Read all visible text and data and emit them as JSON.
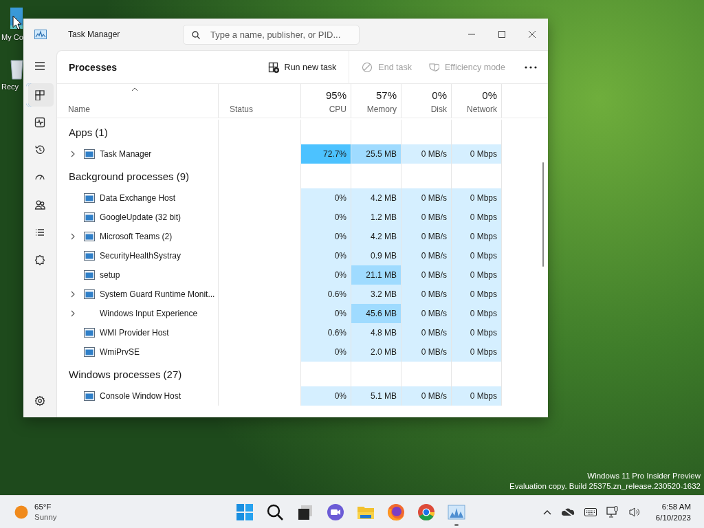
{
  "desktop": {
    "icons": [
      {
        "label": "My Co"
      },
      {
        "label": "Recy"
      }
    ],
    "build_info": [
      "Windows 11 Pro Insider Preview",
      "Evaluation copy. Build 25375.zn_release.230520-1632"
    ]
  },
  "window": {
    "title": "Task Manager",
    "search": {
      "placeholder": "Type a name, publisher, or PID..."
    }
  },
  "nav": {
    "items": [
      {
        "kind": "processes",
        "selected": true
      },
      {
        "kind": "performance",
        "selected": false
      },
      {
        "kind": "history",
        "selected": false
      },
      {
        "kind": "startup",
        "selected": false
      },
      {
        "kind": "users",
        "selected": false
      },
      {
        "kind": "details",
        "selected": false
      },
      {
        "kind": "services",
        "selected": false
      }
    ]
  },
  "page_title": "Processes",
  "toolbar": [
    {
      "label": "Run new task",
      "disabled": false
    },
    {
      "label": "End task",
      "disabled": true
    },
    {
      "label": "Efficiency mode",
      "disabled": true
    }
  ],
  "table": {
    "columns": [
      {
        "label": "Name"
      },
      {
        "label": "Status"
      },
      {
        "total": "95%",
        "label": "CPU"
      },
      {
        "total": "57%",
        "label": "Memory"
      },
      {
        "total": "0%",
        "label": "Disk"
      },
      {
        "total": "0%",
        "label": "Network"
      }
    ],
    "groups": [
      {
        "title": "Apps (1)",
        "rows": [
          {
            "name": "Task Manager",
            "expandable": true,
            "icon": true,
            "cells": [
              {
                "text": "72.7%",
                "color": "#4cc2ff"
              },
              {
                "text": "25.5 MB",
                "color": "#9fdbff"
              },
              {
                "text": "0 MB/s",
                "color": "#d5efff"
              },
              {
                "text": "0 Mbps",
                "color": "#d5efff"
              }
            ]
          }
        ]
      },
      {
        "title": "Background processes (9)",
        "rows": [
          {
            "name": "Data Exchange Host",
            "expandable": false,
            "icon": true,
            "cells": [
              {
                "text": "0%",
                "color": "#d5efff"
              },
              {
                "text": "4.2 MB",
                "color": "#d5efff"
              },
              {
                "text": "0 MB/s",
                "color": "#d5efff"
              },
              {
                "text": "0 Mbps",
                "color": "#d5efff"
              }
            ]
          },
          {
            "name": "GoogleUpdate (32 bit)",
            "expandable": false,
            "icon": true,
            "cells": [
              {
                "text": "0%",
                "color": "#d5efff"
              },
              {
                "text": "1.2 MB",
                "color": "#d5efff"
              },
              {
                "text": "0 MB/s",
                "color": "#d5efff"
              },
              {
                "text": "0 Mbps",
                "color": "#d5efff"
              }
            ]
          },
          {
            "name": "Microsoft Teams (2)",
            "expandable": true,
            "icon": true,
            "cells": [
              {
                "text": "0%",
                "color": "#d5efff"
              },
              {
                "text": "4.2 MB",
                "color": "#d5efff"
              },
              {
                "text": "0 MB/s",
                "color": "#d5efff"
              },
              {
                "text": "0 Mbps",
                "color": "#d5efff"
              }
            ]
          },
          {
            "name": "SecurityHealthSystray",
            "expandable": false,
            "icon": true,
            "cells": [
              {
                "text": "0%",
                "color": "#d5efff"
              },
              {
                "text": "0.9 MB",
                "color": "#d5efff"
              },
              {
                "text": "0 MB/s",
                "color": "#d5efff"
              },
              {
                "text": "0 Mbps",
                "color": "#d5efff"
              }
            ]
          },
          {
            "name": "setup",
            "expandable": false,
            "icon": true,
            "cells": [
              {
                "text": "0%",
                "color": "#d5efff"
              },
              {
                "text": "21.1 MB",
                "color": "#9fdbff"
              },
              {
                "text": "0 MB/s",
                "color": "#d5efff"
              },
              {
                "text": "0 Mbps",
                "color": "#d5efff"
              }
            ]
          },
          {
            "name": "System Guard Runtime Monit...",
            "expandable": true,
            "icon": true,
            "cells": [
              {
                "text": "0.6%",
                "color": "#d5efff"
              },
              {
                "text": "3.2 MB",
                "color": "#d5efff"
              },
              {
                "text": "0 MB/s",
                "color": "#d5efff"
              },
              {
                "text": "0 Mbps",
                "color": "#d5efff"
              }
            ]
          },
          {
            "name": "Windows Input Experience",
            "expandable": true,
            "icon": false,
            "cells": [
              {
                "text": "0%",
                "color": "#d5efff"
              },
              {
                "text": "45.6 MB",
                "color": "#9fdbff"
              },
              {
                "text": "0 MB/s",
                "color": "#d5efff"
              },
              {
                "text": "0 Mbps",
                "color": "#d5efff"
              }
            ]
          },
          {
            "name": "WMI Provider Host",
            "expandable": false,
            "icon": true,
            "cells": [
              {
                "text": "0.6%",
                "color": "#d5efff"
              },
              {
                "text": "4.8 MB",
                "color": "#d5efff"
              },
              {
                "text": "0 MB/s",
                "color": "#d5efff"
              },
              {
                "text": "0 Mbps",
                "color": "#d5efff"
              }
            ]
          },
          {
            "name": "WmiPrvSE",
            "expandable": false,
            "icon": true,
            "cells": [
              {
                "text": "0%",
                "color": "#d5efff"
              },
              {
                "text": "2.0 MB",
                "color": "#d5efff"
              },
              {
                "text": "0 MB/s",
                "color": "#d5efff"
              },
              {
                "text": "0 Mbps",
                "color": "#d5efff"
              }
            ]
          }
        ]
      },
      {
        "title": "Windows processes (27)",
        "rows": [
          {
            "name": "Console Window Host",
            "expandable": false,
            "icon": true,
            "cells": [
              {
                "text": "0%",
                "color": "#d5efff"
              },
              {
                "text": "5.1 MB",
                "color": "#d5efff"
              },
              {
                "text": "0 MB/s",
                "color": "#d5efff"
              },
              {
                "text": "0 Mbps",
                "color": "#d5efff"
              }
            ]
          }
        ]
      }
    ]
  },
  "taskbar": {
    "weather": {
      "temperature": "65°F",
      "condition": "Sunny"
    },
    "apps": [
      {
        "kind": "start",
        "running": false
      },
      {
        "kind": "search",
        "running": false
      },
      {
        "kind": "taskview",
        "running": false
      },
      {
        "kind": "chat",
        "running": false
      },
      {
        "kind": "explorer",
        "running": false
      },
      {
        "kind": "firefox",
        "running": false
      },
      {
        "kind": "chrome",
        "running": false
      },
      {
        "kind": "taskmanager",
        "running": true
      }
    ],
    "time": "6:58 AM",
    "date": "6/10/2023"
  }
}
